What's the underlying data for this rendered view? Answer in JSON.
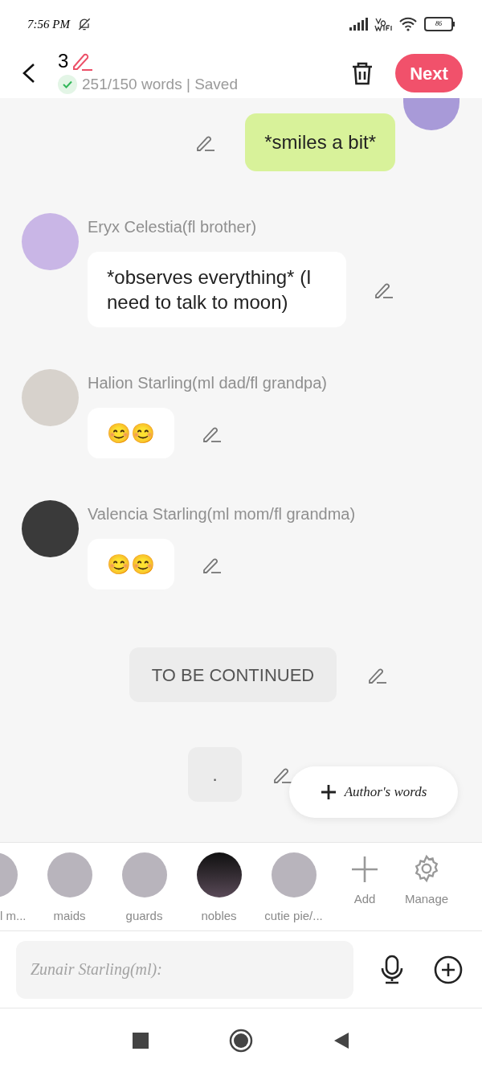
{
  "status_bar": {
    "time": "7:56 PM",
    "battery": "86"
  },
  "header": {
    "chapter": "3",
    "word_count": "251/150 words | Saved",
    "saved": true,
    "next_button": "Next"
  },
  "messages": [
    {
      "kind": "self",
      "text": "*smiles a bit*"
    },
    {
      "kind": "other",
      "name": "Eryx Celestia(fl brother)",
      "text": "*observes everything* (I need to talk to moon)"
    },
    {
      "kind": "other",
      "name": "Halion Starling(ml dad/fl grandpa)",
      "text": "😊😊"
    },
    {
      "kind": "other",
      "name": "Valencia Starling(ml mom/fl grandma)",
      "text": "😊😊"
    },
    {
      "kind": "narration",
      "text": "TO BE CONTINUED"
    },
    {
      "kind": "narration",
      "text": "."
    }
  ],
  "author_words_button": "Author's words",
  "characters": [
    {
      "label": "l m...",
      "kind": "photo"
    },
    {
      "label": "maids",
      "kind": "photo"
    },
    {
      "label": "guards",
      "kind": "photo"
    },
    {
      "label": "nobles",
      "kind": "silhouette"
    },
    {
      "label": "cutie pie/...",
      "kind": "photo"
    }
  ],
  "add_label": "Add",
  "manage_label": "Manage",
  "input": {
    "placeholder": "Zunair Starling(ml):"
  }
}
